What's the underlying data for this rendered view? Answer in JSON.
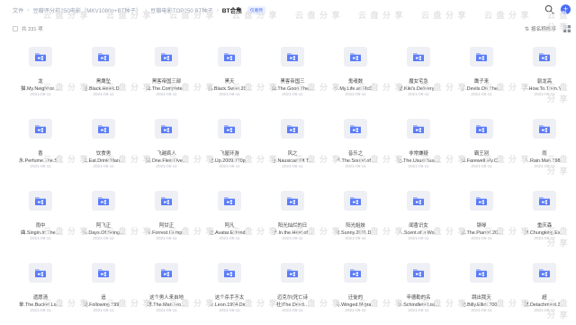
{
  "breadcrumb": {
    "items": [
      "文件",
      "豆瓣评分前250电影（MKV1080p+BT种子）",
      "豆瓣电影TOP250 BT种子"
    ],
    "current": "BT合集",
    "badge": "仅看我"
  },
  "toolbar": {
    "count": "共 231 项",
    "sort_label": "按名称排序"
  },
  "watermark": "云 盘 分 享",
  "colors": {
    "accent": "#4a6cf7",
    "folder_bg": "#eef0f5"
  },
  "items": [
    {
      "l1": "龙",
      "l2": "猫.My.Neighbor.…",
      "date": "2021-06-11"
    },
    {
      "l1": "黑鹰坠",
      "l2": "落.Black.Hawk.D…",
      "date": "2021-06-11"
    },
    {
      "l1": "黑客帝国三部",
      "l2": "曲.The.Complete…",
      "date": "2021-06-11"
    },
    {
      "l1": "黑天",
      "l2": "鹅.Black.Swan.20…",
      "date": "2021-06-11"
    },
    {
      "l1": "黑客帝国三",
      "l2": "曲.The.Good.The…",
      "date": "2021-06-11"
    },
    {
      "l1": "鬼魂数",
      "l2": "事.My.Life.as.McD…",
      "date": "2021-06-11"
    },
    {
      "l1": "魔女宅急",
      "l2": "便.Kiki's.Delivery…",
      "date": "2021-06-11"
    },
    {
      "l1": "鹰子来",
      "l2": "了.Devils.On.The…",
      "date": "2021-06-11"
    },
    {
      "l1": "驯龙高",
      "l2": "手.How.To.Train.Y…",
      "date": "2021-06-11"
    },
    {
      "l1": "香",
      "l2": "水.Perfume.The.S…",
      "date": "2021-06-11"
    },
    {
      "l1": "饮食男",
      "l2": "女.Eat.Drink.Man…",
      "date": "2021-06-11"
    },
    {
      "l1": "飞越疯人",
      "l2": "院.One.Flew.Ove…",
      "date": "2021-06-11"
    },
    {
      "l1": "飞屋环游",
      "l2": "记.Up.2009.720p…",
      "date": "2021-06-11"
    },
    {
      "l1": "风之",
      "l2": "谷.Nausicaä.Of.T…",
      "date": "2021-06-11"
    },
    {
      "l1": "音乐之",
      "l2": "声.The.Sound.of…",
      "date": "2021-06-11"
    },
    {
      "l1": "非常嫌疑",
      "l2": "犯.The.Usual.Sus…",
      "date": "2021-06-11"
    },
    {
      "l1": "霸王别",
      "l2": "姬.Farewell.My.C…",
      "date": "2021-06-11"
    },
    {
      "l1": "雨",
      "l2": "人.Rain.Man.198…",
      "date": "2021-06-11"
    },
    {
      "l1": "雨中",
      "l2": "曲.Singin.In.The…",
      "date": "2021-06-11"
    },
    {
      "l1": "阿飞正",
      "l2": "传.Days.Of.Being…",
      "date": "2021-06-11"
    },
    {
      "l1": "阿甘正",
      "l2": "传.Forrest.Gump…",
      "date": "2021-06-11"
    },
    {
      "l1": "阿凡",
      "l2": "达.Avatar.Extend…",
      "date": "2021-06-11"
    },
    {
      "l1": "阳光灿烂的日",
      "l2": "子.In.the.Heat.of…",
      "date": "2021-06-11"
    },
    {
      "l1": "阳光姐妹",
      "l2": "淘.Sunny.2011.D…",
      "date": "2021-06-11"
    },
    {
      "l1": "闻香识女",
      "l2": "人.Scent.of.a.Wo…",
      "date": "2021-06-11"
    },
    {
      "l1": "钢琴",
      "l2": "家.The.Pianist.20…",
      "date": "2021-06-11"
    },
    {
      "l1": "重庆森",
      "l2": "林.Chungking.Ex…",
      "date": "2021-06-11"
    },
    {
      "l1": "遗愿清",
      "l2": "单.The.Bucket.Lis…",
      "date": "2021-06-11"
    },
    {
      "l1": "追",
      "l2": "随.Following.199…",
      "date": "2021-06-11"
    },
    {
      "l1": "这个男人来自地",
      "l2": "球.The.Man.Fro…",
      "date": "2021-06-11"
    },
    {
      "l1": "这个杀手不太",
      "l2": "冷.Leon.1994.Dir…",
      "date": "2021-06-11"
    },
    {
      "l1": "迈克尔(死亡诗",
      "l2": "社)The.Dead…",
      "date": "2021-06-11"
    },
    {
      "l1": "迁徙的",
      "l2": "鸟.Winged.Migra…",
      "date": "2021-06-11"
    },
    {
      "l1": "辛德勒的名",
      "l2": "单.Schindlers.List…",
      "date": "2021-06-11"
    },
    {
      "l1": "跳出我天",
      "l2": "地.Billy.Elliot.200…",
      "date": "2021-06-11"
    },
    {
      "l1": "超",
      "l2": "脱.Detachment.2…",
      "date": "2021-06-11"
    }
  ]
}
